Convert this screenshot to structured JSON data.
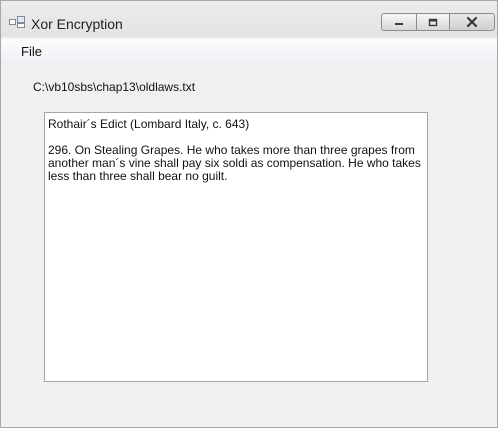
{
  "window": {
    "title": "Xor Encryption",
    "icon": "app-window-icon",
    "buttons": {
      "minimize_icon": "minimize-icon",
      "maximize_icon": "maximize-icon",
      "close_icon": "close-icon"
    }
  },
  "menu": {
    "items": [
      {
        "label": "File"
      }
    ]
  },
  "file_path": "C:\\vb10sbs\\chap13\\oldlaws.txt",
  "text_content": {
    "title_line": "Rothair´s Edict (Lombard Italy, c. 643)",
    "body": "296. On Stealing Grapes. He who takes more than three grapes from another man´s vine shall pay six soldi as compensation. He who takes less than three shall bear no guilt."
  },
  "colors": {
    "window_bg": "#f0f0f0",
    "close_button_accent": "#c75050"
  }
}
